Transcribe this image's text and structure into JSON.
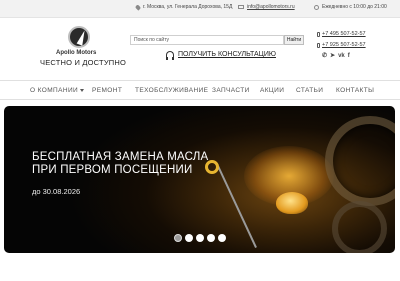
{
  "topbar": {
    "address": "г. Москва, ул. Генерала Дорохова, 15Д",
    "email": "info@apollomotors.ru",
    "hours": "Ежедневно с 10:00 до 21:00"
  },
  "header": {
    "brand": "Apollo Motors",
    "slogan": "ЧЕСТНО И ДОСТУПНО",
    "search_placeholder": "Поиск по сайту",
    "search_button": "Найти",
    "consult_label": "ПОЛУЧИТЬ КОНСУЛЬТАЦИЮ",
    "phones": [
      "+7 495 507-52-57",
      "+7 925 507-52-57"
    ],
    "social_icons": [
      "whatsapp-icon",
      "telegram-icon",
      "vk-icon",
      "facebook-icon"
    ],
    "social_glyphs": [
      "✆",
      "➤",
      "vk",
      "f"
    ]
  },
  "nav": {
    "items": [
      "О КОМПАНИИ",
      "РЕМОНТ",
      "ТЕХОБСЛУЖИВАНИЕ",
      "ЗАПЧАСТИ",
      "АКЦИИ",
      "СТАТЬИ",
      "КОНТАКТЫ"
    ]
  },
  "banner": {
    "title_line1": "БЕСПЛАТНАЯ ЗАМЕНА МАСЛА",
    "title_line2": "ПРИ ПЕРВОМ ПОСЕЩЕНИИ",
    "until": "до 30.08.2026",
    "slides_total": 5,
    "active_slide": 1
  }
}
